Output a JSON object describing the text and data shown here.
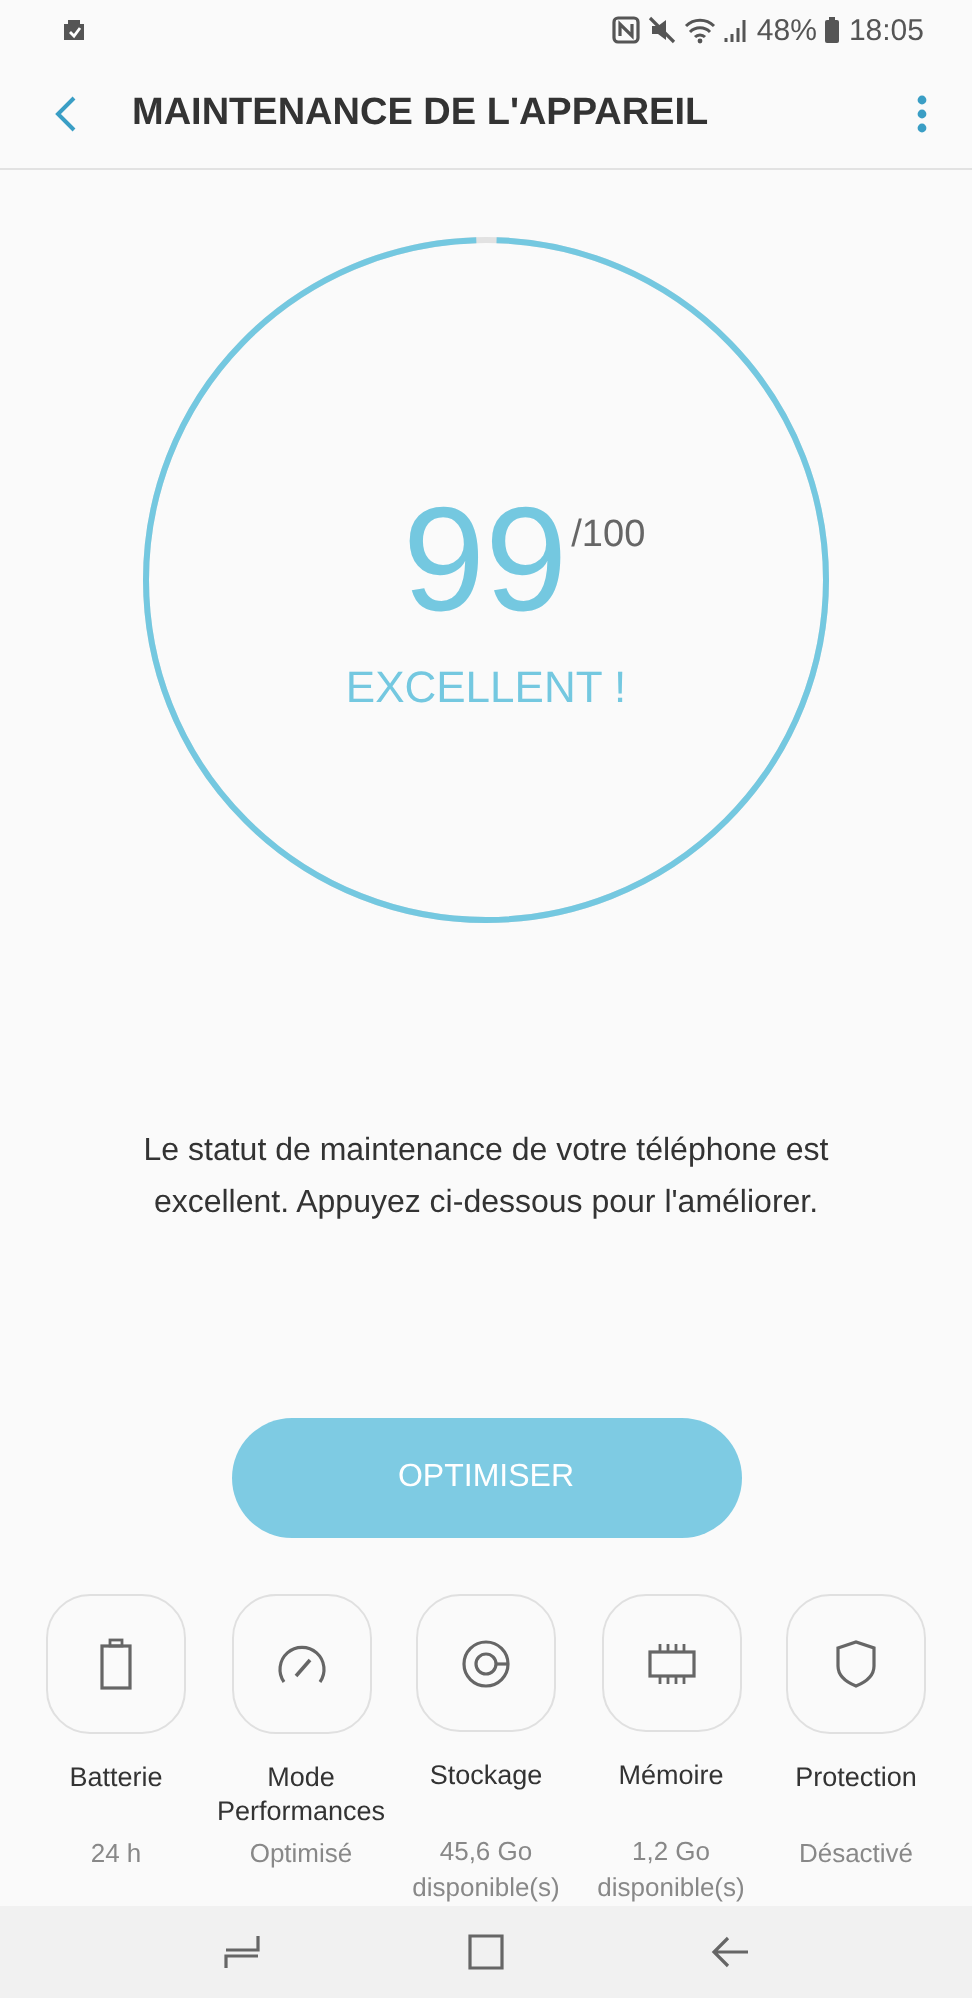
{
  "status_bar": {
    "battery": "48%",
    "time": "18:05"
  },
  "header": {
    "title": "MAINTENANCE DE L'APPAREIL"
  },
  "score": {
    "value": "99",
    "max": "/100",
    "rating": "EXCELLENT !",
    "level": 0.99
  },
  "message": "Le statut de maintenance de votre téléphone est excellent. Appuyez ci-dessous pour l'améliorer.",
  "optimize_button": "OPTIMISER",
  "tiles": [
    {
      "kind": "battery",
      "label": "Batterie",
      "value": "24 h"
    },
    {
      "kind": "performance",
      "label": "Mode Performances",
      "value": "Optimisé"
    },
    {
      "kind": "storage",
      "label": "Stockage",
      "value": "45,6 Go disponible(s)"
    },
    {
      "kind": "memory",
      "label": "Mémoire",
      "value": "1,2 Go disponible(s)"
    },
    {
      "kind": "protection",
      "label": "Protection",
      "value": "Désactivé"
    }
  ]
}
